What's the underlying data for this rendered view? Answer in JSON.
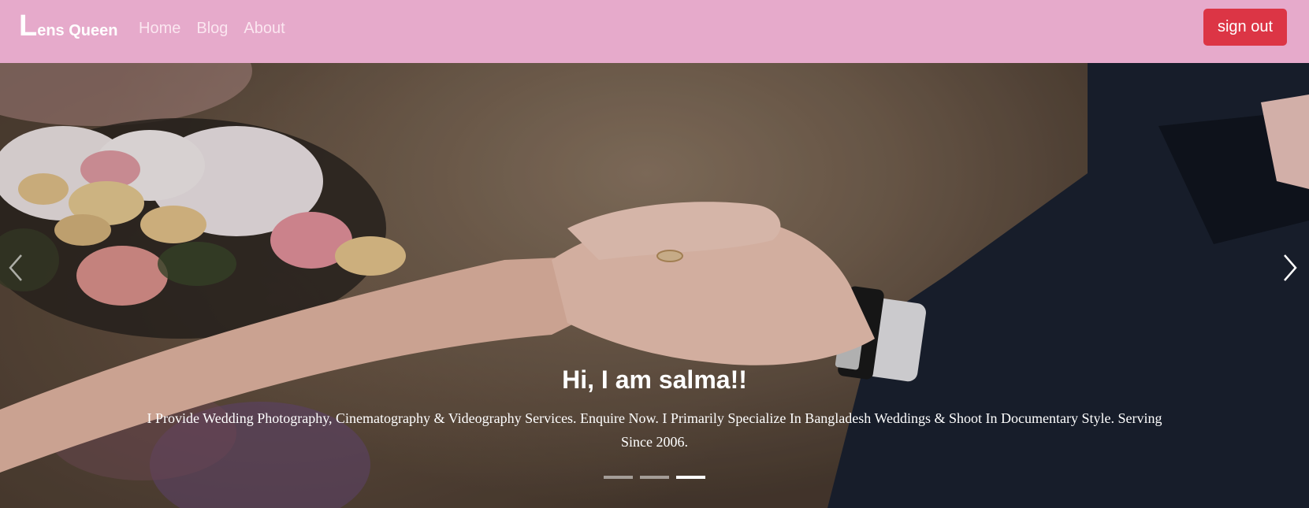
{
  "navbar": {
    "brand_initial": "L",
    "brand_rest": "ens Queen",
    "links": [
      {
        "label": "Home"
      },
      {
        "label": "Blog"
      },
      {
        "label": "About"
      }
    ],
    "signout_label": "sign out",
    "background_color": "#e6aacb",
    "signout_color": "#dc3545"
  },
  "carousel": {
    "image_description_icon": "wedding-ring-photo",
    "caption_title": "Hi, I am salma!!",
    "caption_text": "I Provide Wedding Photography, Cinematography & Videography Services. Enquire Now. I Primarily Specialize In Bangladesh Weddings & Shoot In Documentary Style. Serving Since 2006.",
    "prev_icon": "chevron-left-icon",
    "next_icon": "chevron-right-icon",
    "indicator_count": 3,
    "active_indicator": 3
  }
}
